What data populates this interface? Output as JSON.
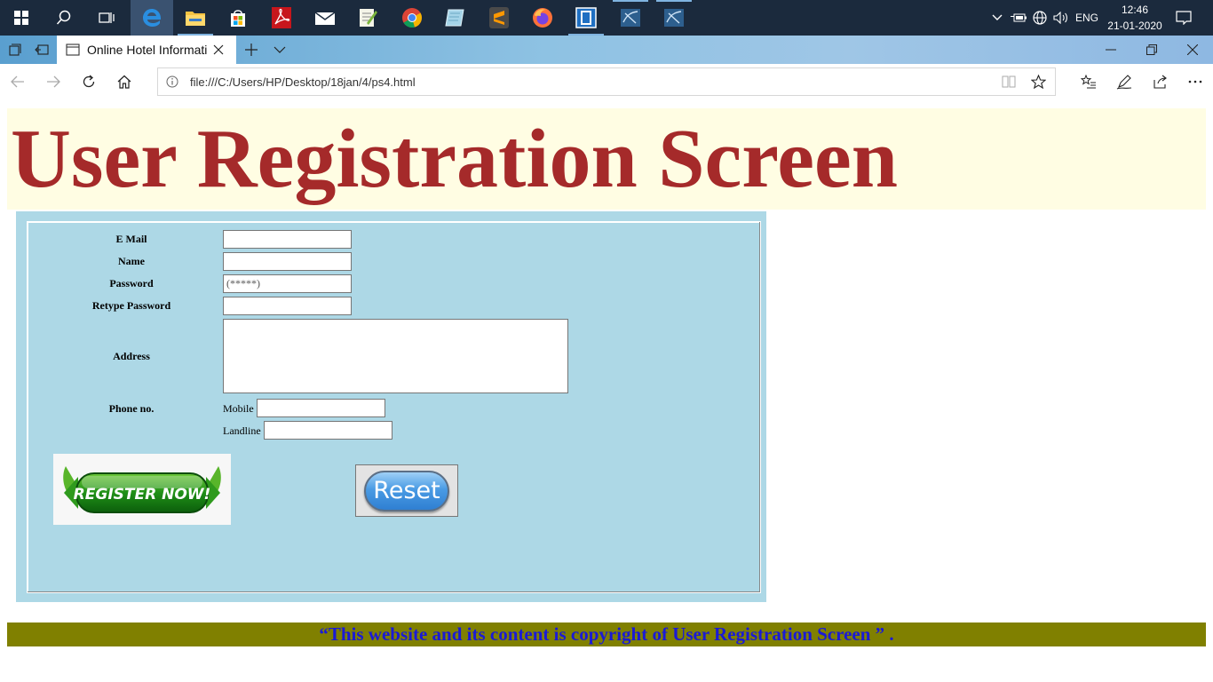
{
  "taskbar": {
    "apps": [
      {
        "name": "start-icon"
      },
      {
        "name": "search-icon"
      },
      {
        "name": "task-view-icon"
      },
      {
        "name": "edge-icon"
      },
      {
        "name": "file-explorer-icon"
      },
      {
        "name": "store-icon"
      },
      {
        "name": "acrobat-icon"
      },
      {
        "name": "mail-icon"
      },
      {
        "name": "notepad-plus-icon"
      },
      {
        "name": "chrome-icon"
      },
      {
        "name": "notebook-icon"
      },
      {
        "name": "sublime-icon"
      },
      {
        "name": "firefox-icon"
      },
      {
        "name": "app-icon"
      },
      {
        "name": "workbench-icon"
      },
      {
        "name": "workbench-2-icon"
      }
    ],
    "language": "ENG",
    "time": "12:46",
    "date": "21-01-2020"
  },
  "browser": {
    "tab_title": "Online Hotel Informatio",
    "url": "file:///C:/Users/HP/Desktop/18jan/4/ps4.html"
  },
  "page": {
    "title": "User Registration Screen",
    "form": {
      "email_label": "E Mail",
      "name_label": "Name",
      "password_label": "Password",
      "password_value": "(*****)",
      "retype_password_label": "Retype Password",
      "address_label": "Address",
      "phone_label": "Phone no.",
      "mobile_label": "Mobile",
      "landline_label": "Landline",
      "register_text": "REGISTER NOW!",
      "reset_text": "Reset"
    },
    "footer": "“This website and its content is copyright of User Registration Screen ” ."
  },
  "colors": {
    "title": "#a52a2a",
    "header_band": "#fffde3",
    "form_bg": "#add8e6",
    "footer_bg": "#808000",
    "footer_text": "#1a1ad6"
  }
}
